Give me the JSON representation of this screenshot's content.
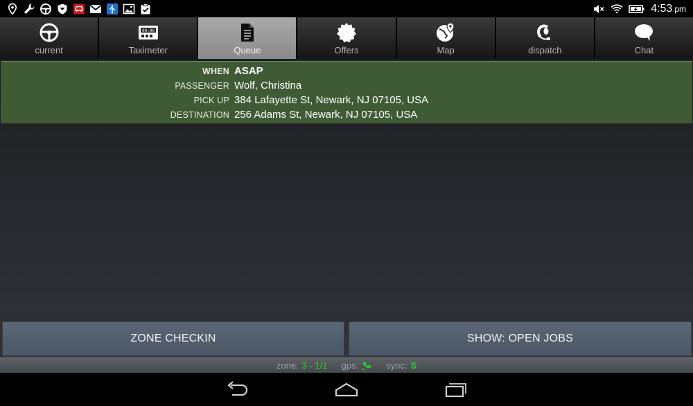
{
  "status_bar": {
    "left_icons": [
      "location-pin-icon",
      "wrench-icon",
      "steering-wheel-icon",
      "shield-icon",
      "car-alert-icon",
      "gmail-icon",
      "usb-icon",
      "gallery-icon",
      "clipboard-check-icon"
    ],
    "right_icons": [
      "volume-muted-icon",
      "wifi-icon",
      "battery-icon"
    ],
    "time": "4:53",
    "ampm": "pm"
  },
  "tabs": [
    {
      "label": "current",
      "icon": "steering-wheel-icon",
      "active": false
    },
    {
      "label": "Taximeter",
      "icon": "taximeter-icon",
      "active": false
    },
    {
      "label": "Queue",
      "icon": "document-icon",
      "active": true
    },
    {
      "label": "Offers",
      "icon": "badge-icon",
      "active": false
    },
    {
      "label": "Map",
      "icon": "globe-pin-icon",
      "active": false
    },
    {
      "label": "dispatch",
      "icon": "headset-icon",
      "active": false
    },
    {
      "label": "Chat",
      "icon": "chat-bubble-icon",
      "active": false
    }
  ],
  "taximeter_display": "00:00",
  "job": {
    "when_label": "WHEN",
    "when_value": "ASAP",
    "passenger_label": "PASSENGER",
    "passenger_value": "Wolf, Christina",
    "pickup_label": "PICK UP",
    "pickup_value": "384 Lafayette St, Newark, NJ 07105, USA",
    "destination_label": "DESTINATION",
    "destination_value": "256 Adams St, Newark, NJ 07105, USA",
    "card_color": "#3f5b36"
  },
  "buttons": {
    "zone_checkin": "ZONE CHECKIN",
    "show_open_jobs": "SHOW: OPEN JOBS"
  },
  "info_bar": {
    "zone_label": "zone:",
    "zone_value": "3 - 1/1",
    "gps_label": "gps:",
    "gps_icon": "satellite-icon",
    "sync_label": "sync:",
    "sync_value": "S",
    "status_color": "#24d224"
  },
  "nav_bar": [
    "back-icon",
    "home-icon",
    "recent-apps-icon"
  ]
}
